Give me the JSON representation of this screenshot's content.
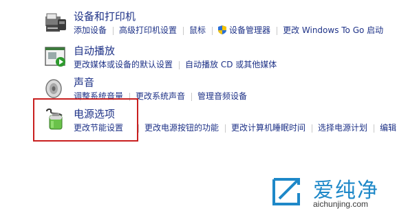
{
  "categories": [
    {
      "title": "设备和打印机",
      "icon": "printer-icon",
      "links": [
        "添加设备",
        "高级打印机设置",
        "鼠标",
        "设备管理器",
        "更改 Windows To Go 启动"
      ]
    },
    {
      "title": "自动播放",
      "icon": "autoplay-icon",
      "links": [
        "更改媒体或设备的默认设置",
        "自动播放 CD 或其他媒体"
      ]
    },
    {
      "title": "声音",
      "icon": "speaker-icon",
      "links": [
        "调整系统音量",
        "更改系统声音",
        "管理音频设备"
      ]
    },
    {
      "title": "电源选项",
      "icon": "battery-icon",
      "links": [
        "更改节能设置",
        "更改电源按钮的功能",
        "更改计算机睡眠时间",
        "选择电源计划",
        "编辑"
      ]
    }
  ],
  "watermark": {
    "brand": "爱纯净",
    "url": "aichunjing.com"
  },
  "colors": {
    "link": "#1e3287",
    "highlight_border": "#c81e1e",
    "watermark": "#1e88c8"
  }
}
